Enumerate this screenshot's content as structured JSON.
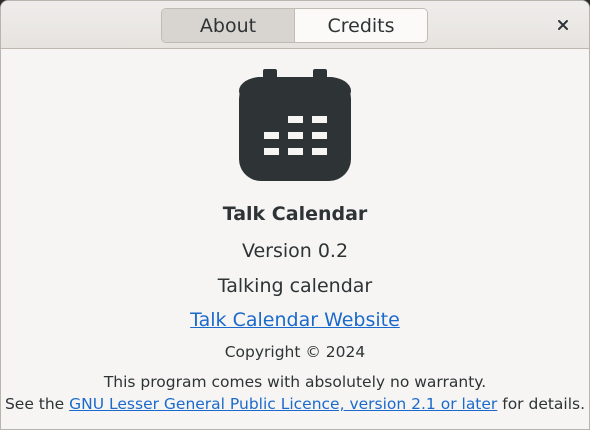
{
  "dialog": {
    "tabs": [
      {
        "label": "About",
        "active": true
      },
      {
        "label": "Credits",
        "active": false
      }
    ],
    "close_icon": "close-icon"
  },
  "about": {
    "icon": "calendar-icon",
    "app_name": "Talk Calendar",
    "version": "Version 0.2",
    "comments": "Talking calendar",
    "website_label": "Talk Calendar Website",
    "copyright": "Copyright © 2024",
    "warranty": "This program comes with absolutely no warranty.",
    "license_prefix": "See the ",
    "license_link": "GNU Lesser General Public Licence, version 2.1 or later",
    "license_suffix": " for details."
  },
  "colors": {
    "link": "#1b6acb",
    "icon": "#2e3436",
    "background": "#f6f5f4"
  }
}
